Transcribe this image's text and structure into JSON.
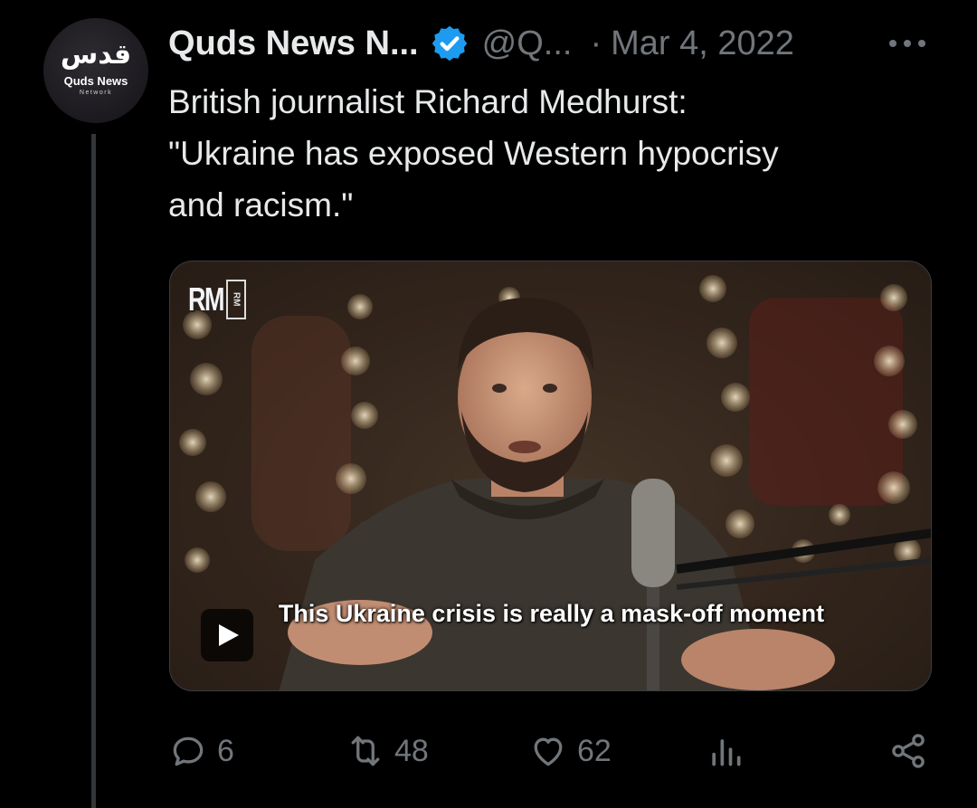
{
  "author": {
    "display_name": "Quds News N...",
    "handle": "@Q...",
    "separator": "·",
    "date": "Mar 4, 2022",
    "verified": true,
    "verified_color": "#1d9bf0",
    "avatar": {
      "logo_mark": "قدس",
      "logo_name": "Quds News",
      "logo_sub": "Network"
    }
  },
  "tweet": {
    "text_lines": [
      "British journalist Richard Medhurst:",
      "\"Ukraine has exposed Western hypocrisy",
      "and racism.\""
    ]
  },
  "media": {
    "type": "video",
    "channel_logo": "RM",
    "channel_logo_box": "RM",
    "caption": "This Ukraine crisis is really a mask-off moment",
    "play_icon": "play-icon"
  },
  "actions": {
    "replies": "6",
    "reposts": "48",
    "likes": "62",
    "views_icon": "views-icon",
    "share_icon": "share-icon"
  },
  "colors": {
    "background": "#000000",
    "text": "#e7e9ea",
    "muted": "#71767b",
    "thread_line": "#333639"
  }
}
